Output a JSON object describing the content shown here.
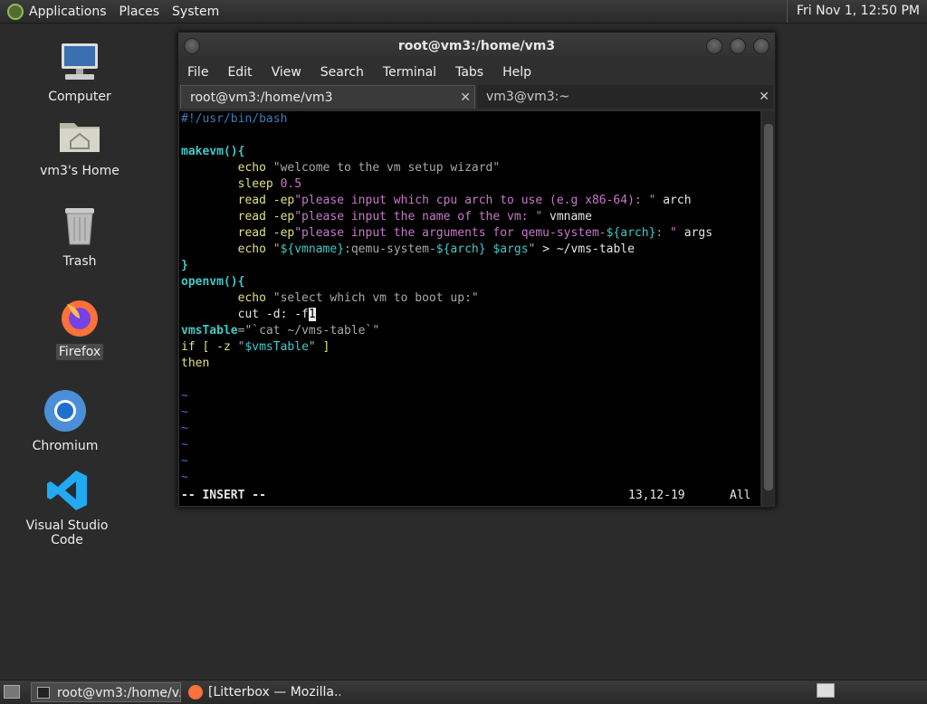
{
  "top_panel": {
    "menus": [
      "Applications",
      "Places",
      "System"
    ],
    "clock": "Fri Nov 1, 12:50 PM"
  },
  "desktop": {
    "icons": [
      {
        "label": "Computer",
        "icon": "computer-icon"
      },
      {
        "label": "vm3's Home",
        "icon": "home-folder-icon"
      },
      {
        "label": "Trash",
        "icon": "trash-icon"
      },
      {
        "label": "Firefox",
        "icon": "firefox-icon"
      },
      {
        "label": "Chromium",
        "icon": "chromium-icon"
      },
      {
        "label": "Visual Studio Code",
        "icon": "vscode-icon"
      }
    ]
  },
  "terminal": {
    "title": "root@vm3:/home/vm3",
    "menu": [
      "File",
      "Edit",
      "View",
      "Search",
      "Terminal",
      "Tabs",
      "Help"
    ],
    "tabs": [
      "root@vm3:/home/vm3",
      "vm3@vm3:~"
    ],
    "lines": {
      "l1": "#!/usr/bin/bash",
      "l3a": "makevm(){",
      "l4a": "        echo ",
      "l4b": "\"welcome to the vm setup wizard\"",
      "l5a": "        sleep ",
      "l5b": "0.5",
      "l6a": "        read -ep",
      "l6b": "\"please input which cpu arch to use (e.g x86-64): \"",
      "l6c": " arch",
      "l7a": "        read -ep",
      "l7b": "\"please input the name of the vm: \"",
      "l7c": " vmname",
      "l8a": "        read -ep",
      "l8b": "\"please input the arguments for qemu-system-",
      "l8c": "${arch}",
      "l8d": ": \"",
      "l8e": " args",
      "l9a": "        echo ",
      "l9b": "\"",
      "l9c": "${vmname}",
      "l9d": ":qemu-system-",
      "l9e": "${arch}",
      "l9f": " ",
      "l9g": "$args",
      "l9h": "\"",
      "l9i": " > ~/vms-table",
      "l10": "}",
      "l11": "openvm(){",
      "l12a": "        echo ",
      "l12b": "\"select which vm to boot up:\"",
      "l13a": "        cut -d: -f",
      "l13b": "1",
      "l14a": "vmsTable",
      "l14b": "=\"`cat ~/vms-table`\"",
      "l15a": "if [ -z ",
      "l15b": "\"",
      "l15c": "$vmsTable",
      "l15d": "\"",
      "l15e": " ]",
      "l16": "then",
      "tilde": "~",
      "mode": "-- INSERT --",
      "position": "13,12-19",
      "scroll": "All"
    }
  },
  "taskbar": {
    "tasks": [
      "root@vm3:/home/v...",
      "[Litterbox — Mozilla..."
    ]
  }
}
